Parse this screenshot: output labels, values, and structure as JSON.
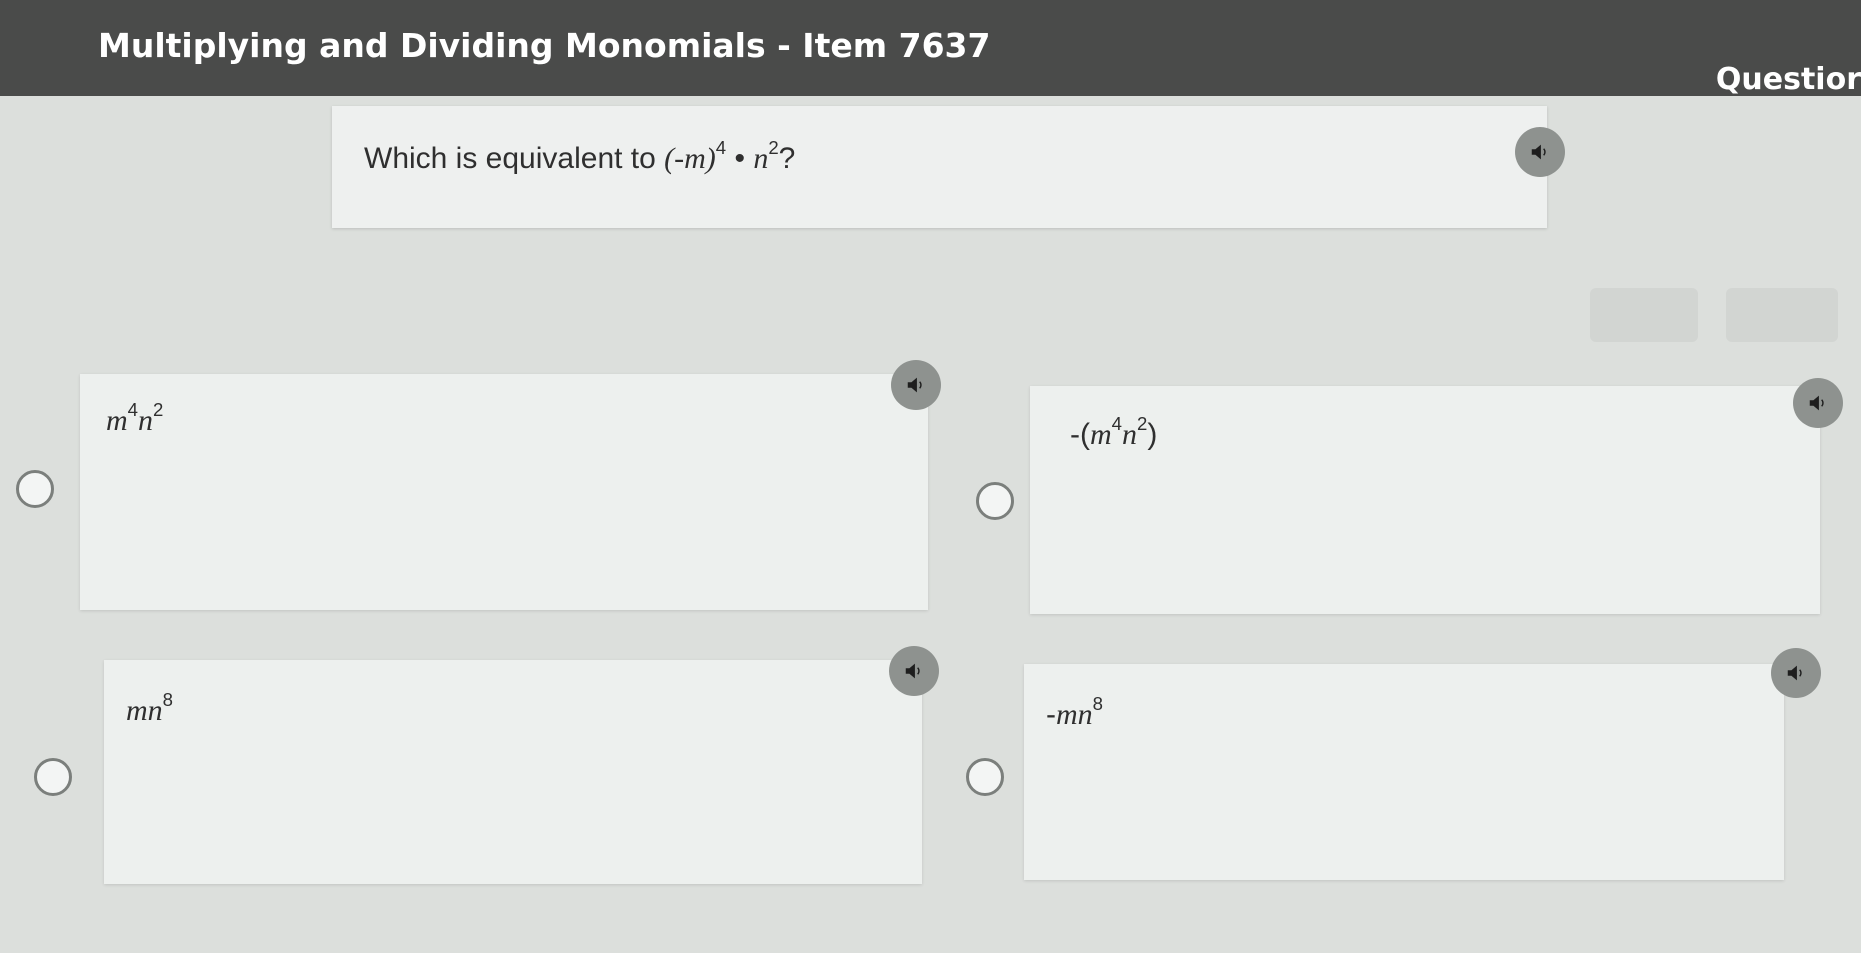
{
  "header": {
    "title": "Multiplying and Dividing Monomials - Item 7637",
    "right_label": "Questior"
  },
  "question": {
    "prefix": "Which is equivalent to ",
    "base": "(-m)",
    "exp1": "4",
    "dot": " • ",
    "var": "n",
    "exp2": "2",
    "suffix": "?"
  },
  "toolbar": {
    "left_button": "",
    "right_button": ""
  },
  "options": [
    {
      "pre": "",
      "v1": "m",
      "e1": "4",
      "v2": "n",
      "e2": "2",
      "post": ""
    },
    {
      "pre": "-(",
      "v1": "m",
      "e1": "4",
      "v2": "n",
      "e2": "2",
      "post": ")"
    },
    {
      "pre": "",
      "v1": "mn",
      "e1": "8"
    },
    {
      "pre": "-",
      "v1": "mn",
      "e1": "8"
    }
  ],
  "icons": {
    "speaker": "speaker-icon",
    "radio": "radio-icon"
  }
}
